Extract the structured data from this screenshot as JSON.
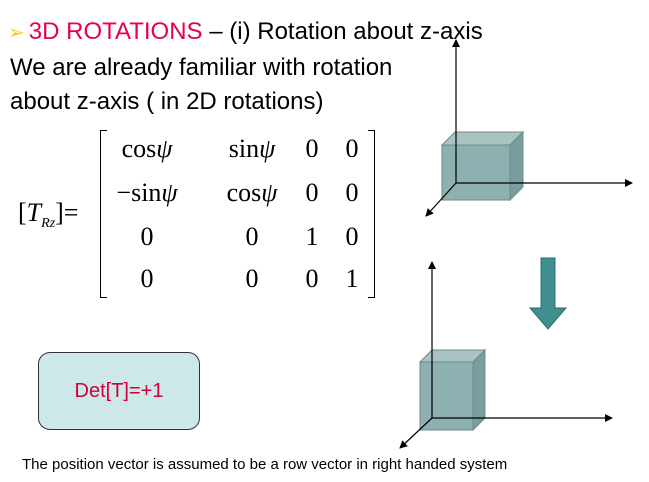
{
  "title": {
    "bullet": "➢",
    "highlight": "3D ROTATIONS",
    "rest": " – (i) Rotation about z-axis"
  },
  "intro": {
    "line1": "We are already familiar with rotation",
    "line2": "about z-axis ( in 2D rotations)"
  },
  "matrix": {
    "lhs_open": "[",
    "lhs_symbol": "T",
    "lhs_subscript": "Rz",
    "lhs_close": "]=",
    "rows": [
      [
        {
          "fn": "cos",
          "arg": "ψ"
        },
        {
          "fn": "sin",
          "arg": "ψ"
        },
        {
          "fn": "0",
          "arg": ""
        },
        {
          "fn": "0",
          "arg": ""
        }
      ],
      [
        {
          "fn": "−sin",
          "arg": "ψ"
        },
        {
          "fn": "cos",
          "arg": "ψ"
        },
        {
          "fn": "0",
          "arg": ""
        },
        {
          "fn": "0",
          "arg": ""
        }
      ],
      [
        {
          "fn": "0",
          "arg": ""
        },
        {
          "fn": "0",
          "arg": ""
        },
        {
          "fn": "1",
          "arg": ""
        },
        {
          "fn": "0",
          "arg": ""
        }
      ],
      [
        {
          "fn": "0",
          "arg": ""
        },
        {
          "fn": "0",
          "arg": ""
        },
        {
          "fn": "0",
          "arg": ""
        },
        {
          "fn": "1",
          "arg": ""
        }
      ]
    ]
  },
  "determinant": "Det[T]=+1",
  "footnote": "The position vector is assumed to be a row vector in right handed system",
  "colors": {
    "title_highlight": "#e8004b",
    "bullet": "#f2d000",
    "det_text": "#d0003a",
    "det_box_fill": "#cce8e8",
    "cube_fill": "#8fb0b0",
    "arrow_fill": "#3f8f8f"
  },
  "icons": {
    "bullet": "arrow-bullet-icon",
    "down_arrow": "down-arrow-icon"
  }
}
